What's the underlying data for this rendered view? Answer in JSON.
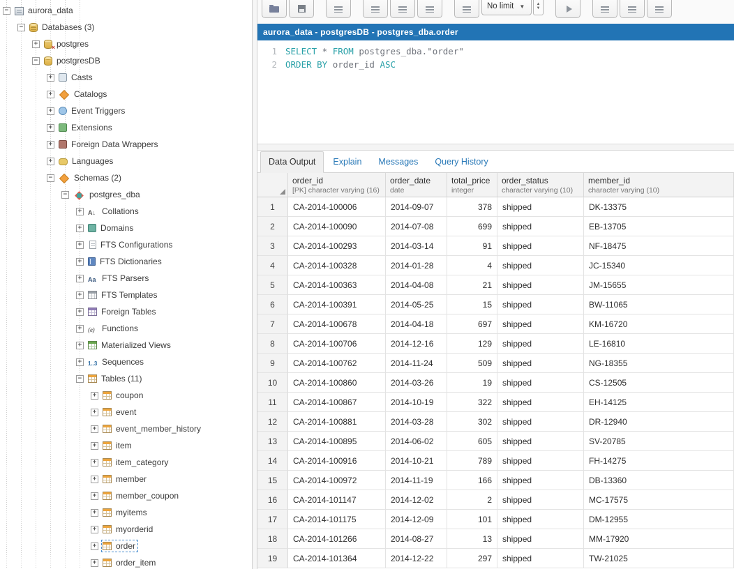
{
  "window": {
    "title_bar": "aurora_data - postgresDB - postgres_dba.order"
  },
  "toolbar": {
    "limit": "No limit"
  },
  "editor": {
    "line_numbers": [
      "1",
      "2"
    ],
    "lines": [
      [
        {
          "t": "SELECT",
          "c": "kw"
        },
        {
          "t": " * ",
          "c": "pl"
        },
        {
          "t": "FROM",
          "c": "kw"
        },
        {
          "t": " postgres_dba.\"order\"",
          "c": "pl"
        }
      ],
      [
        {
          "t": "ORDER BY",
          "c": "kw"
        },
        {
          "t": " order_id ",
          "c": "pl"
        },
        {
          "t": "ASC",
          "c": "kw"
        }
      ]
    ]
  },
  "output": {
    "tabs": [
      {
        "label": "Data Output",
        "active": true
      },
      {
        "label": "Explain",
        "active": false
      },
      {
        "label": "Messages",
        "active": false
      },
      {
        "label": "Query History",
        "active": false
      }
    ]
  },
  "table": {
    "columns": [
      {
        "name": "order_id",
        "sub": "[PK] character varying (16)",
        "align": "left"
      },
      {
        "name": "order_date",
        "sub": "date",
        "align": "left"
      },
      {
        "name": "total_price",
        "sub": "integer",
        "align": "right"
      },
      {
        "name": "order_status",
        "sub": "character varying (10)",
        "align": "left"
      },
      {
        "name": "member_id",
        "sub": "character varying (10)",
        "align": "left"
      }
    ],
    "rows": [
      [
        "CA-2014-100006",
        "2014-09-07",
        "378",
        "shipped",
        "DK-13375"
      ],
      [
        "CA-2014-100090",
        "2014-07-08",
        "699",
        "shipped",
        "EB-13705"
      ],
      [
        "CA-2014-100293",
        "2014-03-14",
        "91",
        "shipped",
        "NF-18475"
      ],
      [
        "CA-2014-100328",
        "2014-01-28",
        "4",
        "shipped",
        "JC-15340"
      ],
      [
        "CA-2014-100363",
        "2014-04-08",
        "21",
        "shipped",
        "JM-15655"
      ],
      [
        "CA-2014-100391",
        "2014-05-25",
        "15",
        "shipped",
        "BW-11065"
      ],
      [
        "CA-2014-100678",
        "2014-04-18",
        "697",
        "shipped",
        "KM-16720"
      ],
      [
        "CA-2014-100706",
        "2014-12-16",
        "129",
        "shipped",
        "LE-16810"
      ],
      [
        "CA-2014-100762",
        "2014-11-24",
        "509",
        "shipped",
        "NG-18355"
      ],
      [
        "CA-2014-100860",
        "2014-03-26",
        "19",
        "shipped",
        "CS-12505"
      ],
      [
        "CA-2014-100867",
        "2014-10-19",
        "322",
        "shipped",
        "EH-14125"
      ],
      [
        "CA-2014-100881",
        "2014-03-28",
        "302",
        "shipped",
        "DR-12940"
      ],
      [
        "CA-2014-100895",
        "2014-06-02",
        "605",
        "shipped",
        "SV-20785"
      ],
      [
        "CA-2014-100916",
        "2014-10-21",
        "789",
        "shipped",
        "FH-14275"
      ],
      [
        "CA-2014-100972",
        "2014-11-19",
        "166",
        "shipped",
        "DB-13360"
      ],
      [
        "CA-2014-101147",
        "2014-12-02",
        "2",
        "shipped",
        "MC-17575"
      ],
      [
        "CA-2014-101175",
        "2014-12-09",
        "101",
        "shipped",
        "DM-12955"
      ],
      [
        "CA-2014-101266",
        "2014-08-27",
        "13",
        "shipped",
        "MM-17920"
      ],
      [
        "CA-2014-101364",
        "2014-12-22",
        "297",
        "shipped",
        "TW-21025"
      ]
    ]
  },
  "sidebar": {
    "items": [
      {
        "label": "aurora_data",
        "level": 0,
        "exp": "minus",
        "icon": "server"
      },
      {
        "label": "Databases (3)",
        "level": 1,
        "exp": "minus",
        "icon": "db-group"
      },
      {
        "label": "postgres",
        "level": 2,
        "exp": "plus",
        "icon": "db-disconnected"
      },
      {
        "label": "postgresDB",
        "level": 2,
        "exp": "minus",
        "icon": "db"
      },
      {
        "label": "Casts",
        "level": 3,
        "exp": "plus",
        "icon": "cast"
      },
      {
        "label": "Catalogs",
        "level": 3,
        "exp": "plus",
        "icon": "catalog"
      },
      {
        "label": "Event Triggers",
        "level": 3,
        "exp": "plus",
        "icon": "event-trigger"
      },
      {
        "label": "Extensions",
        "level": 3,
        "exp": "plus",
        "icon": "extension"
      },
      {
        "label": "Foreign Data Wrappers",
        "level": 3,
        "exp": "plus",
        "icon": "foreign-data-wrapper"
      },
      {
        "label": "Languages",
        "level": 3,
        "exp": "plus",
        "icon": "language"
      },
      {
        "label": "Schemas (2)",
        "level": 3,
        "exp": "minus",
        "icon": "schemas"
      },
      {
        "label": "postgres_dba",
        "level": 4,
        "exp": "minus",
        "icon": "schema"
      },
      {
        "label": "Collations",
        "level": 5,
        "exp": "plus",
        "icon": "collation"
      },
      {
        "label": "Domains",
        "level": 5,
        "exp": "plus",
        "icon": "domain"
      },
      {
        "label": "FTS Configurations",
        "level": 5,
        "exp": "plus",
        "icon": "fts-configuration"
      },
      {
        "label": "FTS Dictionaries",
        "level": 5,
        "exp": "plus",
        "icon": "fts-dictionary"
      },
      {
        "label": "FTS Parsers",
        "level": 5,
        "exp": "plus",
        "icon": "fts-parser"
      },
      {
        "label": "FTS Templates",
        "level": 5,
        "exp": "plus",
        "icon": "fts-template"
      },
      {
        "label": "Foreign Tables",
        "level": 5,
        "exp": "plus",
        "icon": "foreign-table"
      },
      {
        "label": "Functions",
        "level": 5,
        "exp": "plus",
        "icon": "function"
      },
      {
        "label": "Materialized Views",
        "level": 5,
        "exp": "plus",
        "icon": "materialized-view"
      },
      {
        "label": "Sequences",
        "level": 5,
        "exp": "plus",
        "icon": "sequence"
      },
      {
        "label": "Tables (11)",
        "level": 5,
        "exp": "minus",
        "icon": "tables"
      },
      {
        "label": "coupon",
        "level": 6,
        "exp": "plus",
        "icon": "table"
      },
      {
        "label": "event",
        "level": 6,
        "exp": "plus",
        "icon": "table"
      },
      {
        "label": "event_member_history",
        "level": 6,
        "exp": "plus",
        "icon": "table"
      },
      {
        "label": "item",
        "level": 6,
        "exp": "plus",
        "icon": "table"
      },
      {
        "label": "item_category",
        "level": 6,
        "exp": "plus",
        "icon": "table"
      },
      {
        "label": "member",
        "level": 6,
        "exp": "plus",
        "icon": "table"
      },
      {
        "label": "member_coupon",
        "level": 6,
        "exp": "plus",
        "icon": "table"
      },
      {
        "label": "myitems",
        "level": 6,
        "exp": "plus",
        "icon": "table"
      },
      {
        "label": "myorderid",
        "level": 6,
        "exp": "plus",
        "icon": "table"
      },
      {
        "label": "order",
        "level": 6,
        "exp": "plus",
        "icon": "table",
        "selected": true
      },
      {
        "label": "order_item",
        "level": 6,
        "exp": "plus",
        "icon": "table"
      }
    ]
  }
}
